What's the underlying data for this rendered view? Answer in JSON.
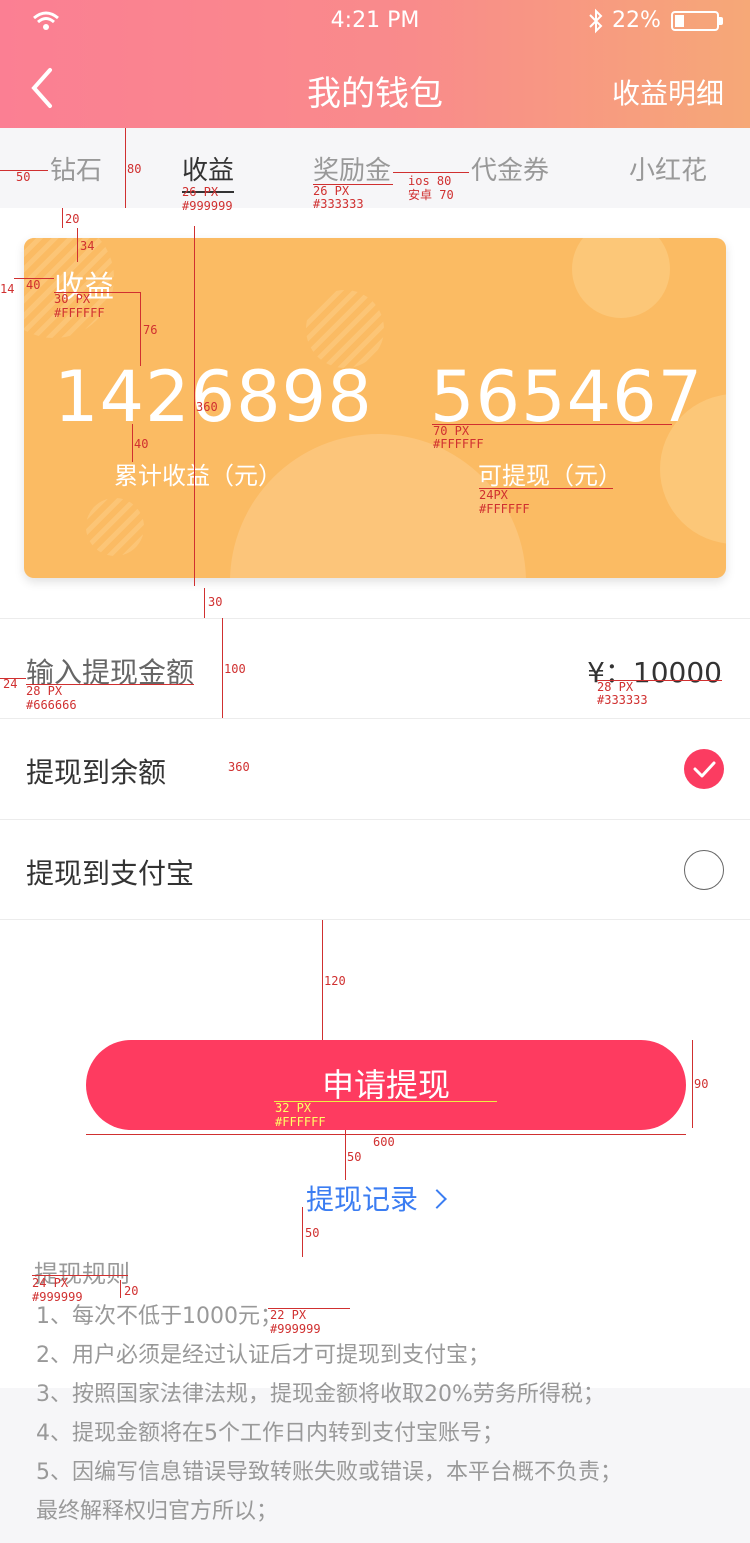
{
  "status_bar": {
    "time": "4:21 PM",
    "battery": "22%"
  },
  "header": {
    "title": "我的钱包",
    "right_link": "收益明细"
  },
  "tabs": [
    {
      "label": "钻石",
      "active": false
    },
    {
      "label": "收益",
      "active": true
    },
    {
      "label": "奖励金",
      "active": false
    },
    {
      "label": "代金券",
      "active": false
    },
    {
      "label": "小红花",
      "active": false
    }
  ],
  "card": {
    "label": "收益",
    "total_amount": "1426898",
    "total_label": "累计收益（元）",
    "withdrawable_amount": "565467",
    "withdrawable_label": "可提现（元）",
    "bg_color": "#fbbb63"
  },
  "withdraw_input": {
    "label": "输入提现金额",
    "value": "¥：10000"
  },
  "options": [
    {
      "label": "提现到余额",
      "selected": true
    },
    {
      "label": "提现到支付宝",
      "selected": false
    }
  ],
  "submit_button": {
    "label": "申请提现",
    "color": "#fe3b60"
  },
  "records_link": {
    "label": "提现记录"
  },
  "rules": {
    "title": "提现规则",
    "items": [
      "1、每次不低于1000元；",
      "2、用户必须是经过认证后才可提现到支付宝；",
      "3、按照国家法律法规，提现金额将收取20%劳务所得税；",
      "4、提现金额将在5个工作日内转到支付宝账号；",
      "5、因编写信息错误导致转账失败或错误，本平台概不负责；",
      "最终解释权归官方所以；"
    ]
  },
  "annotations": {
    "tab_gap": "50",
    "tab_height": "80",
    "tab_active_size": "26 PX",
    "tab_active_color": "#999999",
    "tab_size": "26 PX",
    "tab_color": "#333333",
    "tab_spacing_ios": "ios 80",
    "tab_spacing_android": "安卓 70",
    "card_top_gap": "20",
    "card_label_top": "34",
    "card_left_outer": "14",
    "card_left_inner": "40",
    "card_label_size": "30 PX",
    "card_label_color": "#FFFFFF",
    "label_amount_gap": "76",
    "card_height": "360",
    "amount_sub_gap": "40",
    "amount_size": "70 PX",
    "amount_color": "#FFFFFF",
    "sub_size": "24PX",
    "sub_color": "#FFFFFF",
    "card_bottom_gap": "30",
    "input_left": "24",
    "input_label_size": "28 PX",
    "input_label_color": "#666666",
    "row_height": "100",
    "input_value_size": "28 PX",
    "input_value_color": "#333333",
    "options_width": "360",
    "button_top_gap": "120",
    "button_height": "90",
    "button_text_size": "32 PX",
    "button_text_color": "#FFFFFF",
    "button_width": "600",
    "link_gap": "50",
    "rules_gap": "50",
    "rules_title_size": "24 PX",
    "rules_title_color": "#999999",
    "rules_title_gap": "20",
    "rules_size": "22 PX",
    "rules_color": "#999999"
  }
}
